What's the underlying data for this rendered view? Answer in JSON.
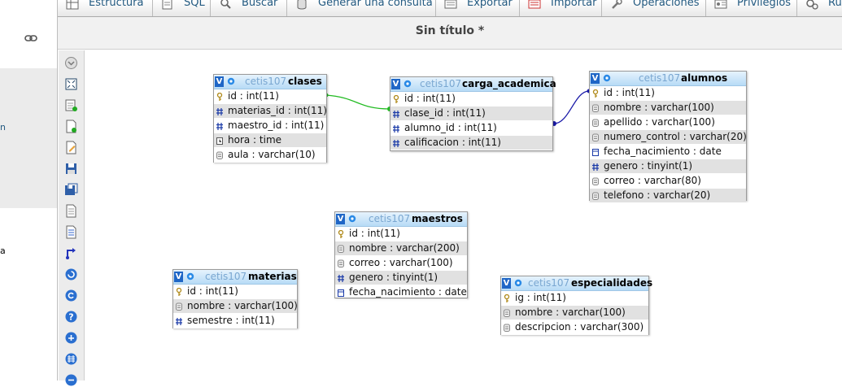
{
  "left_nav": {
    "link_icon": "link-chain-icon",
    "fragments": [
      "n",
      "a"
    ]
  },
  "tabs": [
    {
      "label": "Estructura",
      "icon": "structure-icon"
    },
    {
      "label": "SQL",
      "icon": "sql-icon"
    },
    {
      "label": "Buscar",
      "icon": "search-icon"
    },
    {
      "label": "Generar una consulta",
      "icon": "query-icon"
    },
    {
      "label": "Exportar",
      "icon": "export-icon"
    },
    {
      "label": "Importar",
      "icon": "import-icon"
    },
    {
      "label": "Operaciones",
      "icon": "wrench-icon"
    },
    {
      "label": "Privilegios",
      "icon": "privileges-icon"
    },
    {
      "label": "Ru",
      "icon": "routines-icon"
    }
  ],
  "designer": {
    "title": "Sin título *",
    "tools": [
      "toggle-menu-icon",
      "fullscreen-icon",
      "add-tables-icon",
      "new-page-icon",
      "edit-page-icon",
      "save-icon",
      "save-as-icon",
      "open-page-icon",
      "delete-page-icon",
      "relation-line-icon",
      "reload-icon",
      "help-icon",
      "angular-links-icon",
      "snap-grid-icon",
      "collapse-all-icon"
    ]
  },
  "tables": [
    {
      "id": "clases",
      "db": "cetis107",
      "name": "clases",
      "columns": [
        {
          "text": "id : int(11)",
          "icon": "key-icon"
        },
        {
          "text": "materias_id : int(11)",
          "icon": "numeric-column-icon"
        },
        {
          "text": "maestro_id : int(11)",
          "icon": "numeric-column-icon"
        },
        {
          "text": "hora : time",
          "icon": "time-column-icon"
        },
        {
          "text": "aula : varchar(10)",
          "icon": "text-column-icon"
        }
      ]
    },
    {
      "id": "carga_academica",
      "db": "cetis107",
      "name": "carga_academica",
      "columns": [
        {
          "text": "id : int(11)",
          "icon": "key-icon"
        },
        {
          "text": "clase_id : int(11)",
          "icon": "numeric-column-icon"
        },
        {
          "text": "alumno_id : int(11)",
          "icon": "numeric-column-icon"
        },
        {
          "text": "calificacion : int(11)",
          "icon": "numeric-column-icon"
        }
      ]
    },
    {
      "id": "alumnos",
      "db": "cetis107",
      "name": "alumnos",
      "columns": [
        {
          "text": "id : int(11)",
          "icon": "key-icon"
        },
        {
          "text": "nombre : varchar(100)",
          "icon": "text-column-icon"
        },
        {
          "text": "apellido : varchar(100)",
          "icon": "text-column-icon"
        },
        {
          "text": "numero_control : varchar(20)",
          "icon": "text-column-icon"
        },
        {
          "text": "fecha_nacimiento : date",
          "icon": "date-column-icon"
        },
        {
          "text": "genero : tinyint(1)",
          "icon": "numeric-column-icon"
        },
        {
          "text": "correo : varchar(80)",
          "icon": "text-column-icon"
        },
        {
          "text": "telefono : varchar(20)",
          "icon": "text-column-icon"
        }
      ]
    },
    {
      "id": "maestros",
      "db": "cetis107",
      "name": "maestros",
      "columns": [
        {
          "text": "id : int(11)",
          "icon": "key-icon"
        },
        {
          "text": "nombre : varchar(200)",
          "icon": "text-column-icon"
        },
        {
          "text": "correo : varchar(100)",
          "icon": "text-column-icon"
        },
        {
          "text": "genero : tinyint(1)",
          "icon": "numeric-column-icon"
        },
        {
          "text": "fecha_nacimiento : date",
          "icon": "date-column-icon"
        }
      ]
    },
    {
      "id": "materias",
      "db": "cetis107",
      "name": "materias",
      "columns": [
        {
          "text": "id : int(11)",
          "icon": "key-icon"
        },
        {
          "text": "nombre : varchar(100)",
          "icon": "text-column-icon"
        },
        {
          "text": "semestre : int(11)",
          "icon": "numeric-column-icon"
        }
      ]
    },
    {
      "id": "especialidades",
      "db": "cetis107",
      "name": "especialidades",
      "columns": [
        {
          "text": "ig : int(11)",
          "icon": "key-icon"
        },
        {
          "text": "nombre : varchar(100)",
          "icon": "text-column-icon"
        },
        {
          "text": "descripcion : varchar(300)",
          "icon": "text-column-icon"
        }
      ]
    }
  ],
  "relations": [
    {
      "from": "carga_academica.clase_id",
      "to": "clases.id",
      "color": "#22bb22"
    },
    {
      "from": "carga_academica.alumno_id",
      "to": "alumnos.id",
      "color": "#1a1aa8"
    }
  ],
  "colors": {
    "header_gradient_top": "#e6f3fd",
    "header_gradient_bottom": "#b7dbf6",
    "db_name": "#7aa7d1",
    "row_alt": "#e1e1e1",
    "v_button": "#1f66c6"
  }
}
